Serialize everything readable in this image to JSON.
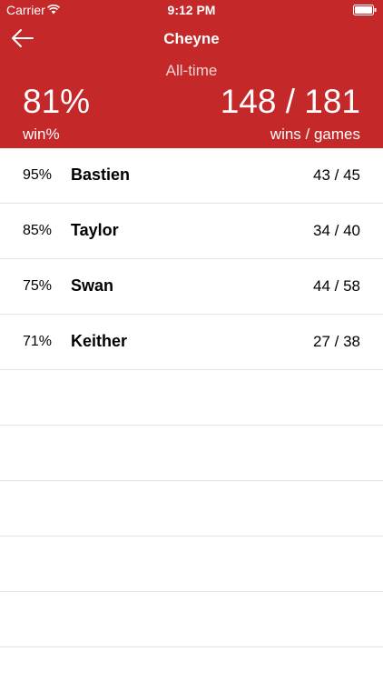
{
  "status_bar": {
    "carrier": "Carrier",
    "time": "9:12 PM"
  },
  "header": {
    "title": "Cheyne",
    "period": "All-time",
    "win_percent": "81%",
    "win_percent_label": "win%",
    "record": "148 / 181",
    "record_label": "wins / games",
    "background_color": "#c52828"
  },
  "rows": [
    {
      "pct": "95%",
      "name": "Bastien",
      "score": "43 / 45"
    },
    {
      "pct": "85%",
      "name": "Taylor",
      "score": "34 / 40"
    },
    {
      "pct": "75%",
      "name": "Swan",
      "score": "44 / 58"
    },
    {
      "pct": "71%",
      "name": "Keither",
      "score": "27 / 38"
    }
  ]
}
